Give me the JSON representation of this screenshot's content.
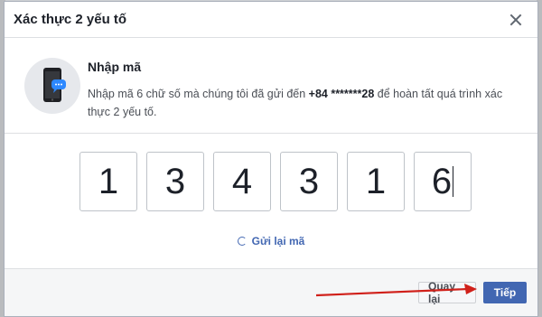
{
  "dialog": {
    "title": "Xác thực 2 yếu tố"
  },
  "intro": {
    "heading": "Nhập mã",
    "text_before": "Nhập mã 6 chữ số mà chúng tôi đã gửi đến ",
    "phone": "+84 *******28",
    "text_after": " để hoàn tất quá trình xác thực 2 yếu tố.",
    "icon": "phone-chat-icon"
  },
  "code": {
    "digits": [
      "1",
      "3",
      "4",
      "3",
      "1",
      "6"
    ]
  },
  "resend": {
    "label": "Gửi lại mã",
    "icon": "refresh-icon"
  },
  "footer": {
    "back_label": "Quay lại",
    "next_label": "Tiếp"
  },
  "colors": {
    "primary": "#4267b2",
    "annotation_arrow": "#d0201a"
  }
}
